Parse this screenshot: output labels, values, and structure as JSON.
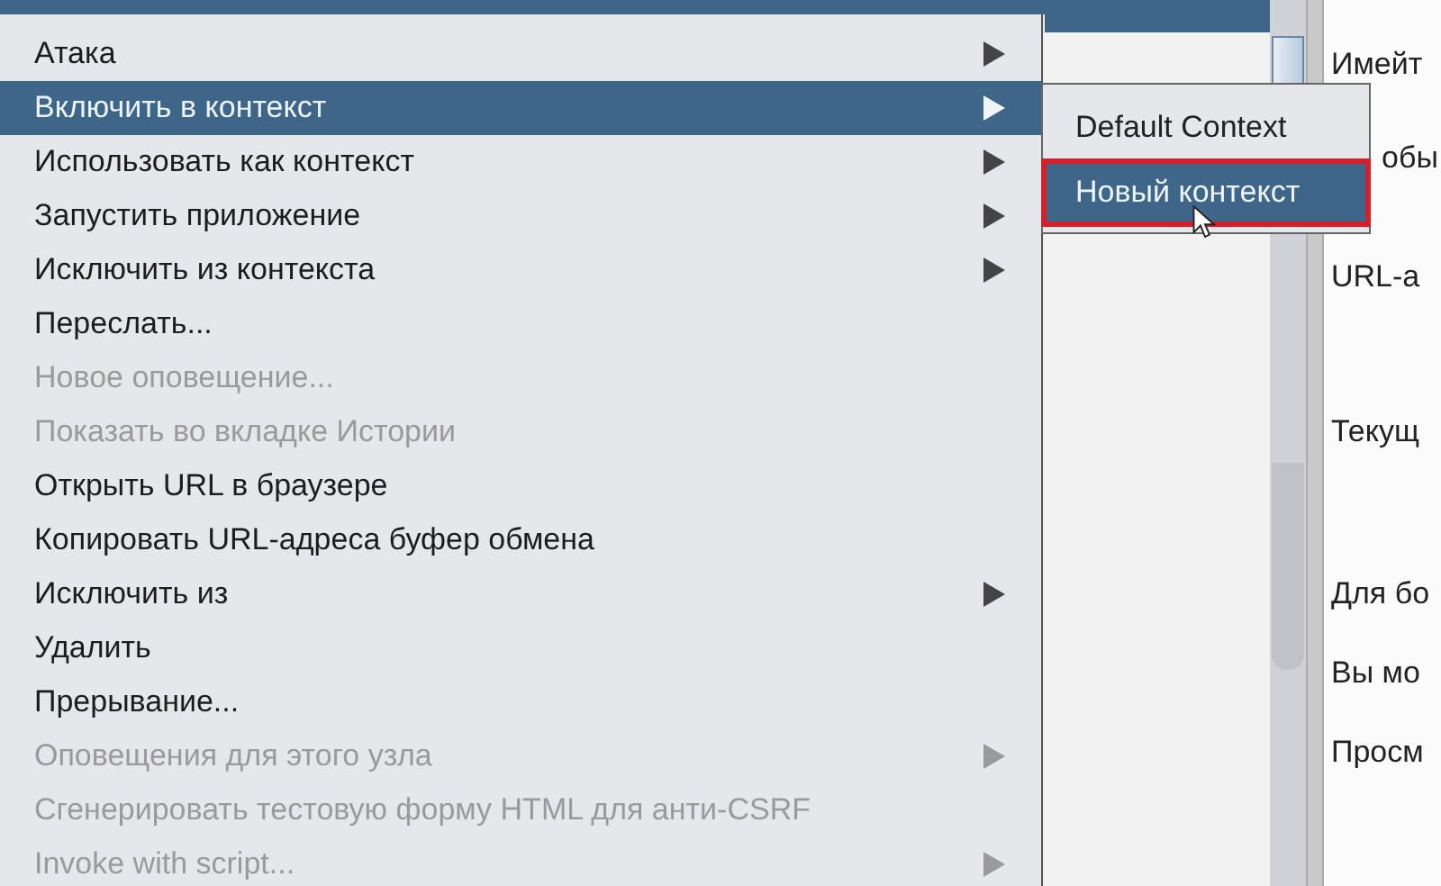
{
  "menu": {
    "items": [
      {
        "label": "Атака",
        "submenu": true,
        "disabled": false,
        "selected": false
      },
      {
        "label": "Включить в контекст",
        "submenu": true,
        "disabled": false,
        "selected": true
      },
      {
        "label": "Использовать как контекст",
        "submenu": true,
        "disabled": false,
        "selected": false
      },
      {
        "label": "Запустить приложение",
        "submenu": true,
        "disabled": false,
        "selected": false
      },
      {
        "label": "Исключить из контекста",
        "submenu": true,
        "disabled": false,
        "selected": false
      },
      {
        "label": "Переслать...",
        "submenu": false,
        "disabled": false,
        "selected": false
      },
      {
        "label": "Новое оповещение...",
        "submenu": false,
        "disabled": true,
        "selected": false
      },
      {
        "label": "Показать во вкладке Истории",
        "submenu": false,
        "disabled": true,
        "selected": false
      },
      {
        "label": "Открыть URL в браузере",
        "submenu": false,
        "disabled": false,
        "selected": false
      },
      {
        "label": "Копировать URL-адреса буфер обмена",
        "submenu": false,
        "disabled": false,
        "selected": false
      },
      {
        "label": "Исключить из",
        "submenu": true,
        "disabled": false,
        "selected": false
      },
      {
        "label": "Удалить",
        "submenu": false,
        "disabled": false,
        "selected": false
      },
      {
        "label": "Прерывание...",
        "submenu": false,
        "disabled": false,
        "selected": false
      },
      {
        "label": "Оповещения для этого узла",
        "submenu": true,
        "disabled": true,
        "selected": false
      },
      {
        "label": "Сгенерировать тестовую форму HTML для анти-CSRF",
        "submenu": false,
        "disabled": true,
        "selected": false
      },
      {
        "label": "Invoke with script...",
        "submenu": true,
        "disabled": true,
        "selected": false
      }
    ]
  },
  "submenu": {
    "items": [
      {
        "label": "Default Context",
        "selected": false,
        "highlighted": false
      },
      {
        "label": "Новый контекст",
        "selected": true,
        "highlighted": true
      }
    ]
  },
  "right_panel": {
    "lines": [
      "Имейт",
      "обы",
      "URL-а",
      "Текущ",
      "Для бо",
      "Вы мо",
      "Просм"
    ]
  }
}
